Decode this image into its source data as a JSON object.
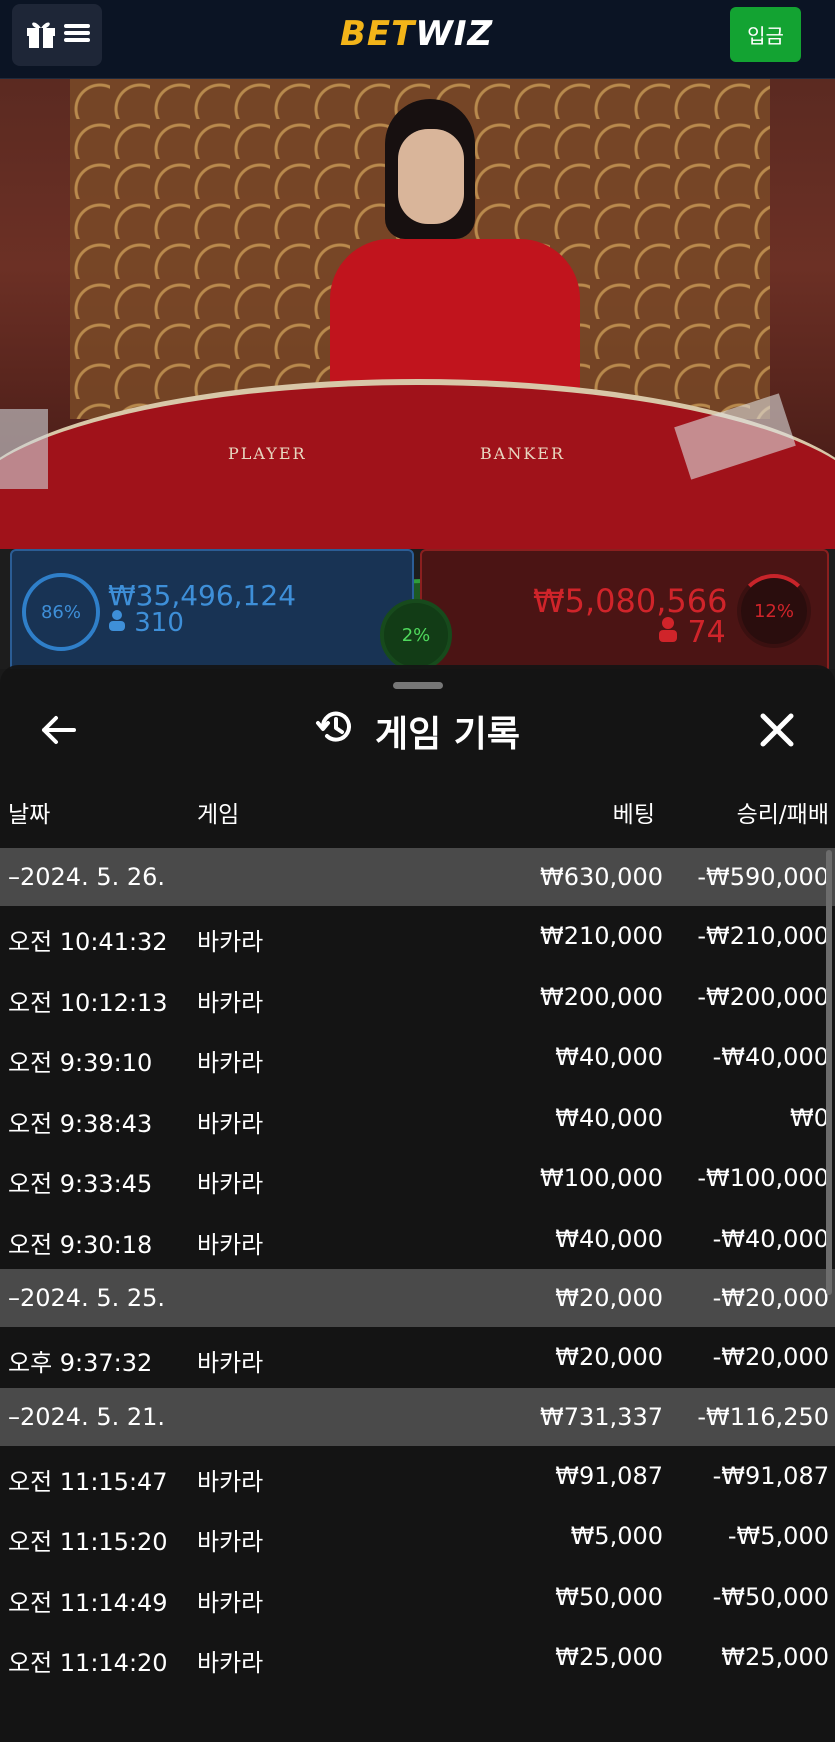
{
  "header": {
    "logo_bet": "BET",
    "logo_wiz": "WIZ",
    "deposit_label": "입금"
  },
  "video": {
    "table_label_left": "PLAYER",
    "table_label_right": "BANKER"
  },
  "betting": {
    "player": {
      "percent": "86%",
      "amount": "₩35,496,124",
      "count": "310",
      "color": "#3e8fd8"
    },
    "banker": {
      "percent": "12%",
      "amount": "₩5,080,566",
      "count": "74",
      "color": "#d0242a"
    },
    "tie": {
      "percent": "2%"
    }
  },
  "history_sheet": {
    "title": "게임 기록",
    "columns": {
      "date": "날짜",
      "game": "게임",
      "bet": "베팅",
      "result": "승리/패배"
    },
    "rows": [
      {
        "type": "date",
        "date": "–2024. 5. 26.",
        "game": "",
        "bet": "₩630,000",
        "result": "-₩590,000"
      },
      {
        "type": "entry",
        "date": "오전 10:41:32",
        "game": "바카라",
        "bet": "₩210,000",
        "result": "-₩210,000"
      },
      {
        "type": "entry",
        "date": "오전 10:12:13",
        "game": "바카라",
        "bet": "₩200,000",
        "result": "-₩200,000"
      },
      {
        "type": "entry",
        "date": "오전 9:39:10",
        "game": "바카라",
        "bet": "₩40,000",
        "result": "-₩40,000"
      },
      {
        "type": "entry",
        "date": "오전 9:38:43",
        "game": "바카라",
        "bet": "₩40,000",
        "result": "₩0"
      },
      {
        "type": "entry",
        "date": "오전 9:33:45",
        "game": "바카라",
        "bet": "₩100,000",
        "result": "-₩100,000"
      },
      {
        "type": "entry",
        "date": "오전 9:30:18",
        "game": "바카라",
        "bet": "₩40,000",
        "result": "-₩40,000"
      },
      {
        "type": "date",
        "date": "–2024. 5. 25.",
        "game": "",
        "bet": "₩20,000",
        "result": "-₩20,000"
      },
      {
        "type": "entry",
        "date": "오후 9:37:32",
        "game": "바카라",
        "bet": "₩20,000",
        "result": "-₩20,000"
      },
      {
        "type": "date",
        "date": "–2024. 5. 21.",
        "game": "",
        "bet": "₩731,337",
        "result": "-₩116,250"
      },
      {
        "type": "entry",
        "date": "오전 11:15:47",
        "game": "바카라",
        "bet": "₩91,087",
        "result": "-₩91,087"
      },
      {
        "type": "entry",
        "date": "오전 11:15:20",
        "game": "바카라",
        "bet": "₩5,000",
        "result": "-₩5,000"
      },
      {
        "type": "entry",
        "date": "오전 11:14:49",
        "game": "바카라",
        "bet": "₩50,000",
        "result": "-₩50,000"
      },
      {
        "type": "entry",
        "date": "오전 11:14:20",
        "game": "바카라",
        "bet": "₩25,000",
        "result": "₩25,000"
      }
    ]
  }
}
